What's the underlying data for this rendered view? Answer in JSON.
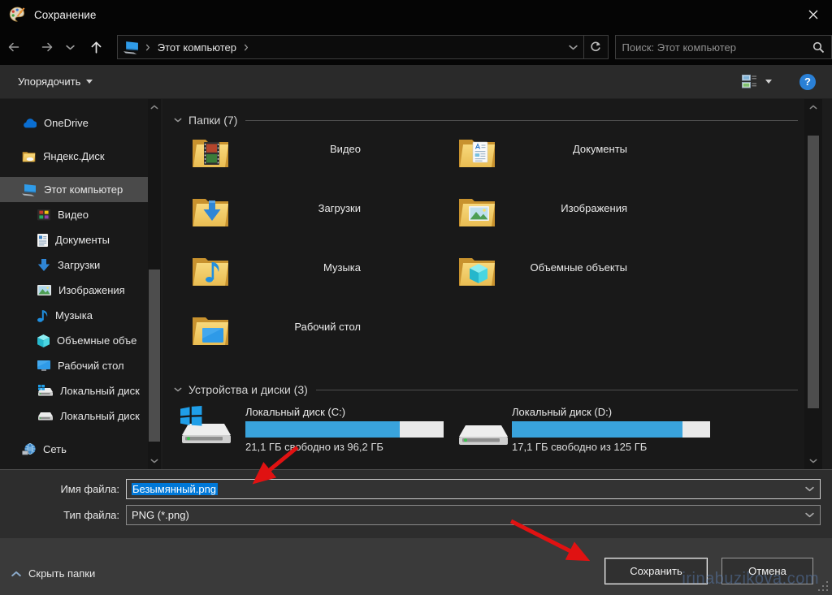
{
  "window": {
    "title": "Сохранение",
    "close_glyph": "✕"
  },
  "nav": {
    "breadcrumb_root": "Этот компьютер",
    "search_placeholder": "Поиск: Этот компьютер"
  },
  "toolbar": {
    "organize_label": "Упорядочить",
    "help_glyph": "?"
  },
  "sidebar": {
    "items": [
      {
        "label": "OneDrive"
      },
      {
        "label": "Яндекс.Диск"
      },
      {
        "label": "Этот компьютер",
        "selected": true
      },
      {
        "label": "Видео"
      },
      {
        "label": "Документы"
      },
      {
        "label": "Загрузки"
      },
      {
        "label": "Изображения"
      },
      {
        "label": "Музыка"
      },
      {
        "label": "Объемные объе"
      },
      {
        "label": "Рабочий стол"
      },
      {
        "label": "Локальный диск"
      },
      {
        "label": "Локальный диск"
      },
      {
        "label": "Сеть"
      }
    ]
  },
  "content": {
    "folders_header": "Папки (7)",
    "folders": [
      {
        "name": "Видео"
      },
      {
        "name": "Документы"
      },
      {
        "name": "Загрузки"
      },
      {
        "name": "Изображения"
      },
      {
        "name": "Музыка"
      },
      {
        "name": "Объемные объекты"
      },
      {
        "name": "Рабочий стол"
      }
    ],
    "devices_header": "Устройства и диски (3)",
    "drives": [
      {
        "name": "Локальный диск (C:)",
        "free": "21,1 ГБ свободно из 96,2 ГБ",
        "used_pct": 78
      },
      {
        "name": "Локальный диск (D:)",
        "free": "17,1 ГБ свободно из 125 ГБ",
        "used_pct": 86
      }
    ]
  },
  "fields": {
    "filename_label": "Имя файла:",
    "filename_value": "Безымянный.png",
    "filetype_label": "Тип файла:",
    "filetype_value": "PNG (*.png)"
  },
  "footer": {
    "hide_folders_label": "Скрыть папки",
    "save_label": "Сохранить",
    "cancel_label": "Отмена"
  },
  "watermark": "irinabuzikova.com",
  "colors": {
    "selection_blue": "#0078d7",
    "drive_bar_blue": "#39a3dc",
    "annotation_arrow_red": "#e01212",
    "help_blue": "#2a80d6"
  }
}
